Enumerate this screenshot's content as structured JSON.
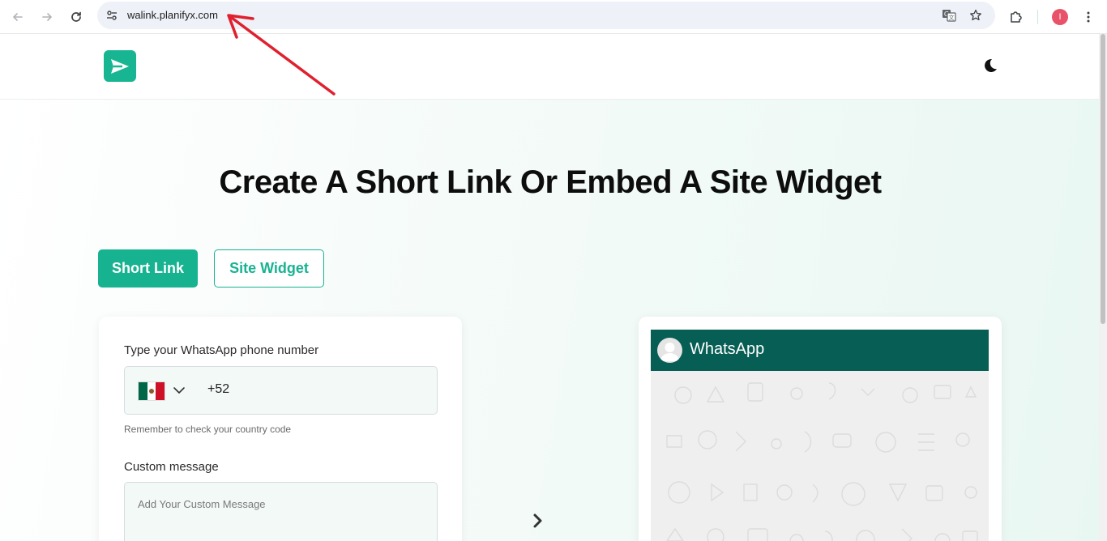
{
  "browser": {
    "url": "walink.planifyx.com",
    "profile_initial": "I"
  },
  "header": {
    "logo_icon": "paper-plane-icon",
    "theme_icon": "moon-icon"
  },
  "hero": {
    "headline": "Create A Short Link Or Embed A Site Widget",
    "tabs": [
      {
        "label": "Short Link",
        "active": true
      },
      {
        "label": "Site Widget",
        "active": false
      }
    ]
  },
  "form": {
    "phone_label": "Type your WhatsApp phone number",
    "country_code": "+52",
    "country_flag": "mexico-flag-icon",
    "hint": "Remember to check your country code",
    "message_label": "Custom message",
    "message_placeholder": "Add Your Custom Message"
  },
  "preview": {
    "app_name": "WhatsApp"
  },
  "colors": {
    "brand": "#17b391",
    "whatsapp_header": "#075e54",
    "annotation": "#e0202e"
  }
}
